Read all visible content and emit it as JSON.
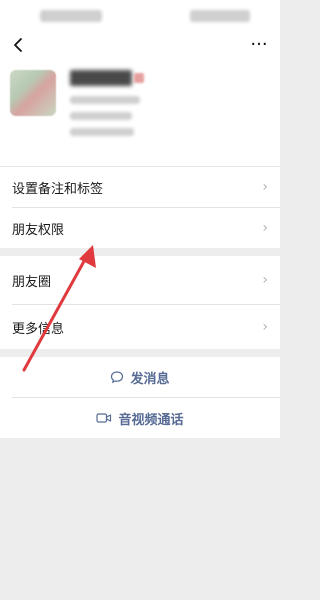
{
  "nav": {
    "more_label": "···"
  },
  "menu": {
    "remark_tags": "设置备注和标签",
    "friend_permissions": "朋友权限",
    "moments": "朋友圈",
    "more_info": "更多信息"
  },
  "actions": {
    "send_message": "发消息",
    "av_call": "音视频通话"
  },
  "colors": {
    "link": "#576b95",
    "annotation_arrow": "#e03a3e"
  }
}
